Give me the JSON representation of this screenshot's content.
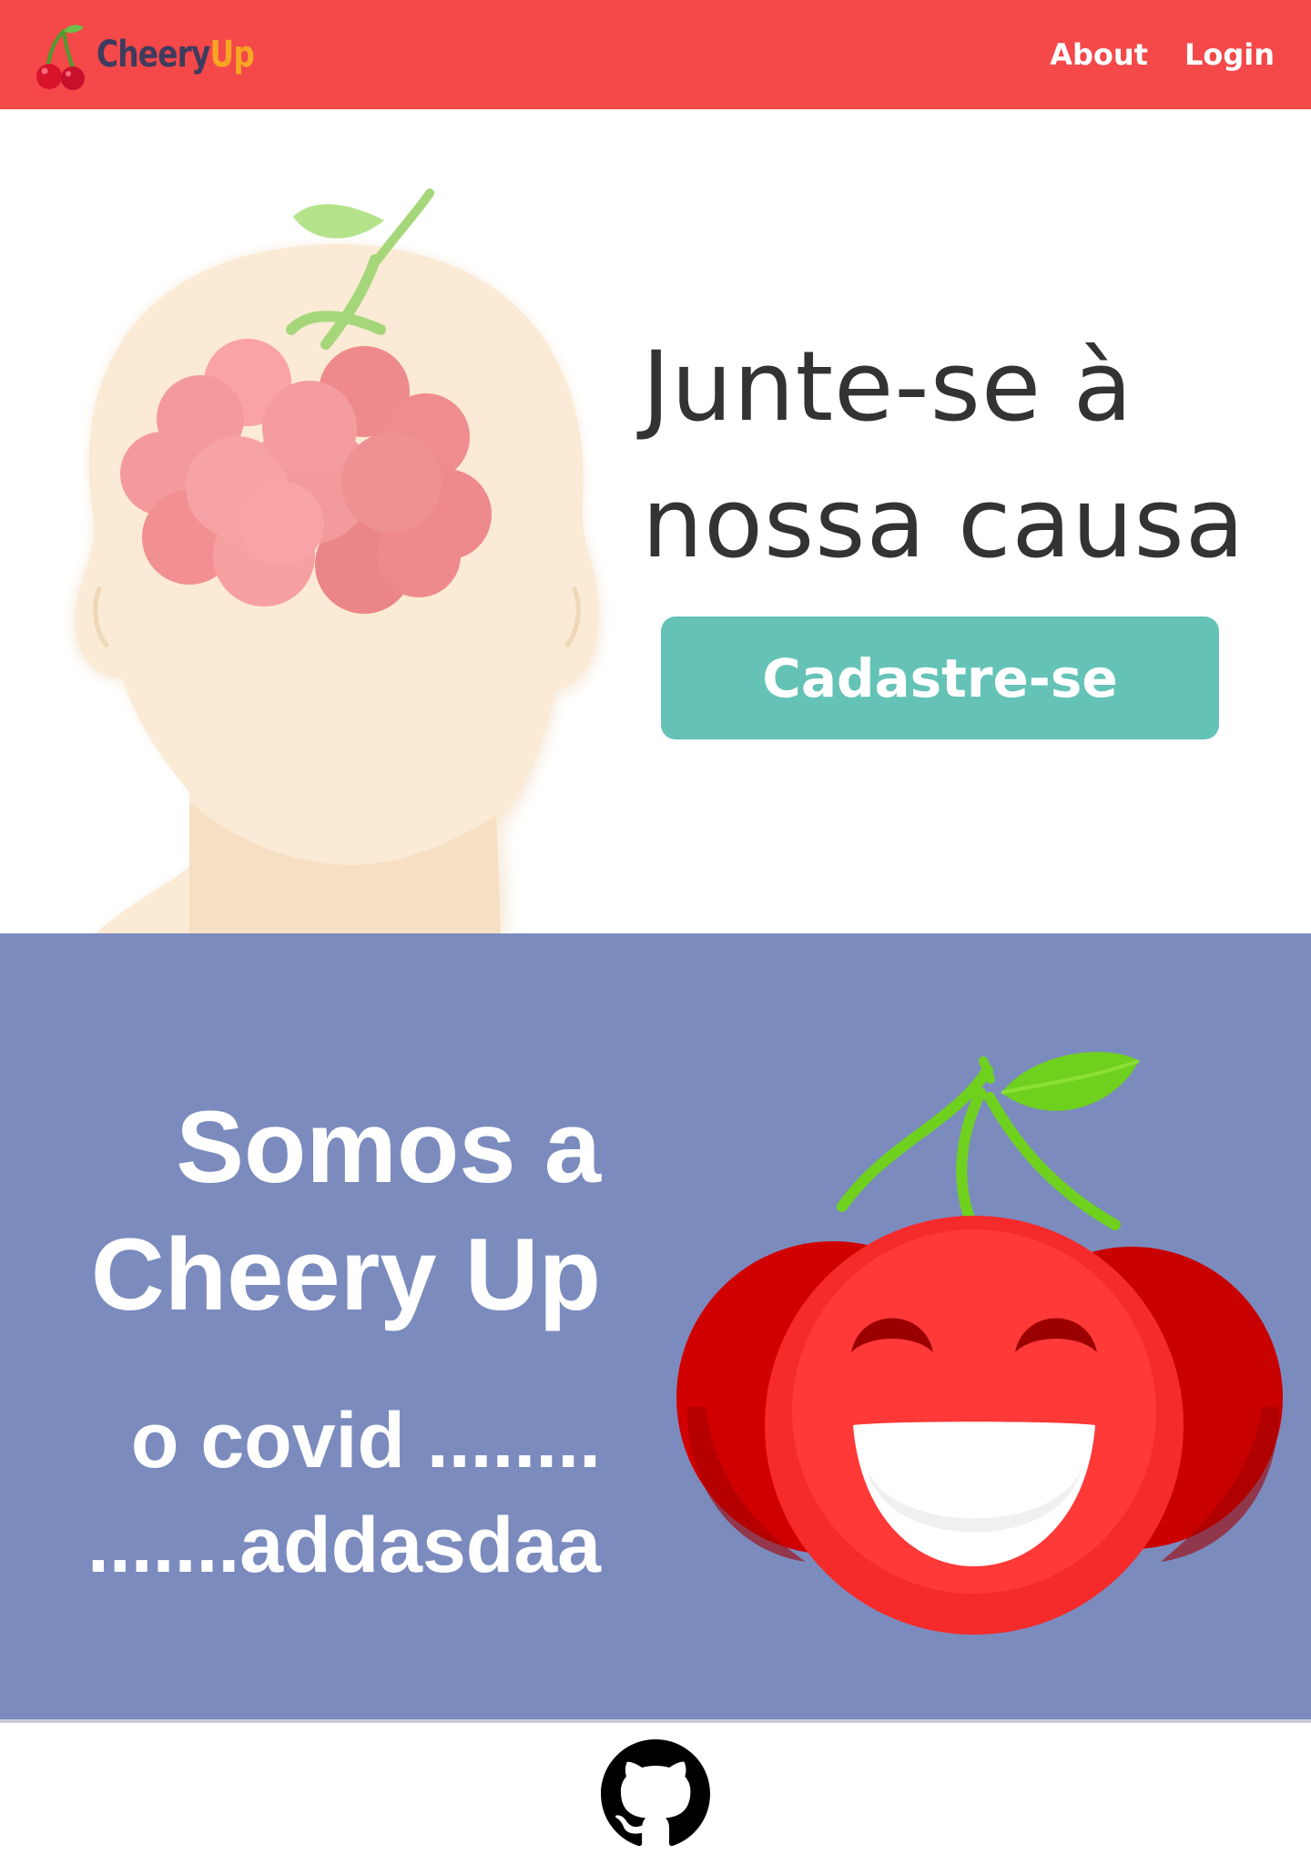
{
  "navbar": {
    "brand": {
      "part1": "Cheery",
      "part2": "Up"
    },
    "links": [
      {
        "label": "About"
      },
      {
        "label": "Login"
      }
    ],
    "colors": {
      "background": "#f44849",
      "brand_dark": "#3d3c5e",
      "brand_accent": "#f6a623"
    }
  },
  "hero": {
    "title": "Junte-se à nossa causa",
    "cta_label": "Cadastre-se",
    "illustration_icon": "head-with-brain-cherry-illustration",
    "colors": {
      "cta": "#64c3b6",
      "title": "#333333"
    }
  },
  "about": {
    "heading": "Somos a Cheery Up",
    "text_line1": "o covid  ........",
    "text_line2": ".......addasdaa",
    "mascot_icon": "smiling-cherry-icon",
    "colors": {
      "background": "#7b8bbe"
    }
  },
  "footer": {
    "github_icon": "github-icon"
  }
}
